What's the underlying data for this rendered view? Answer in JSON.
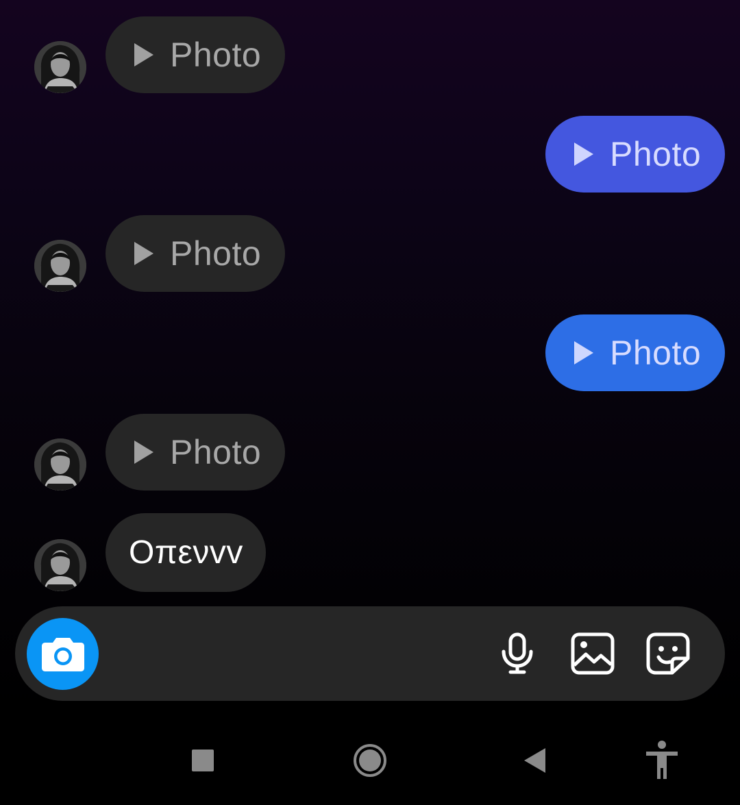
{
  "messages": [
    {
      "direction": "incoming",
      "type": "media",
      "label": "Photo",
      "avatar_icon": "contact-avatar"
    },
    {
      "direction": "outgoing",
      "type": "media",
      "label": "Photo",
      "color": "#4457df"
    },
    {
      "direction": "incoming",
      "type": "media",
      "label": "Photo",
      "avatar_icon": "contact-avatar"
    },
    {
      "direction": "outgoing",
      "type": "media",
      "label": "Photo",
      "color": "#2d6ee6"
    },
    {
      "direction": "incoming",
      "type": "media",
      "label": "Photo",
      "avatar_icon": "contact-avatar"
    },
    {
      "direction": "incoming",
      "type": "text",
      "label": "Οπενvv",
      "avatar_icon": "contact-avatar"
    }
  ],
  "composer": {
    "camera_icon": "camera-icon",
    "camera_color": "#0a95f5",
    "icons": [
      "microphone-icon",
      "gallery-icon",
      "sticker-icon"
    ]
  },
  "navbar": {
    "icons": [
      "recents-icon",
      "home-icon",
      "back-icon",
      "accessibility-icon"
    ]
  },
  "colors": {
    "incoming_bubble": "#262626",
    "background_top": "#14041f",
    "background_bottom": "#000000"
  }
}
